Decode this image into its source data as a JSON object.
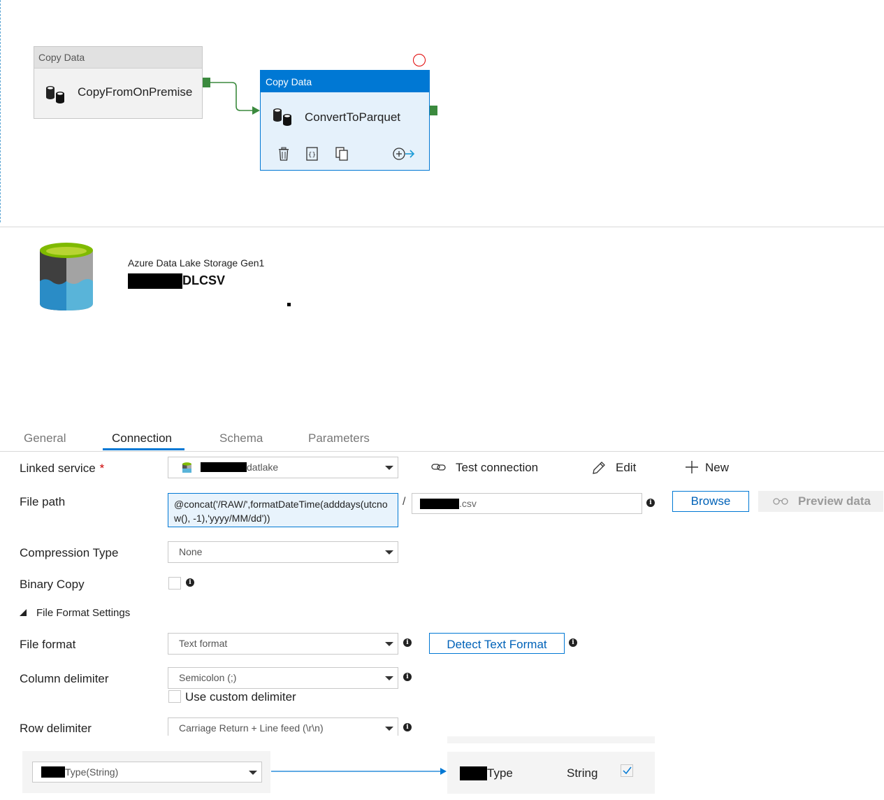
{
  "pipeline": {
    "activities": [
      {
        "type_label": "Copy Data",
        "name": "CopyFromOnPremise"
      },
      {
        "type_label": "Copy Data",
        "name": "ConvertToParquet"
      }
    ],
    "toolbar_icons": [
      "delete-icon",
      "code-icon",
      "clone-icon",
      "add-output-icon"
    ]
  },
  "dataset": {
    "type": "Azure Data Lake Storage Gen1",
    "name_visible_suffix": "DLCSV"
  },
  "tabs": [
    "General",
    "Connection",
    "Schema",
    "Parameters"
  ],
  "active_tab": "Connection",
  "form": {
    "linked_service": {
      "label": "Linked service",
      "required_mark": "*",
      "value_suffix": "datlake",
      "test_connection": "Test connection",
      "edit": "Edit",
      "new": "New"
    },
    "file_path": {
      "label": "File path",
      "folder_expression": "@concat('/RAW/',formatDateTime(adddays(utcnow(), -1),'yyyy/MM/dd'))",
      "separator": "/",
      "file_suffix": ".csv",
      "browse": "Browse",
      "preview": "Preview data"
    },
    "compression_type": {
      "label": "Compression Type",
      "value": "None"
    },
    "binary_copy": {
      "label": "Binary Copy"
    },
    "file_format_settings": {
      "label": "File Format Settings"
    },
    "file_format": {
      "label": "File format",
      "value": "Text format",
      "detect": "Detect Text Format"
    },
    "column_delimiter": {
      "label": "Column delimiter",
      "value": "Semicolon (;)",
      "custom": "Use custom delimiter"
    },
    "row_delimiter": {
      "label": "Row delimiter",
      "value": "Carriage Return + Line feed (\\r\\n)"
    }
  },
  "mapping": {
    "source_suffix": "Type(String)",
    "target_suffix": "Type",
    "target_type": "String"
  },
  "colors": {
    "accent": "#0078d4",
    "success": "#3b8a3e",
    "error": "#e00000"
  }
}
